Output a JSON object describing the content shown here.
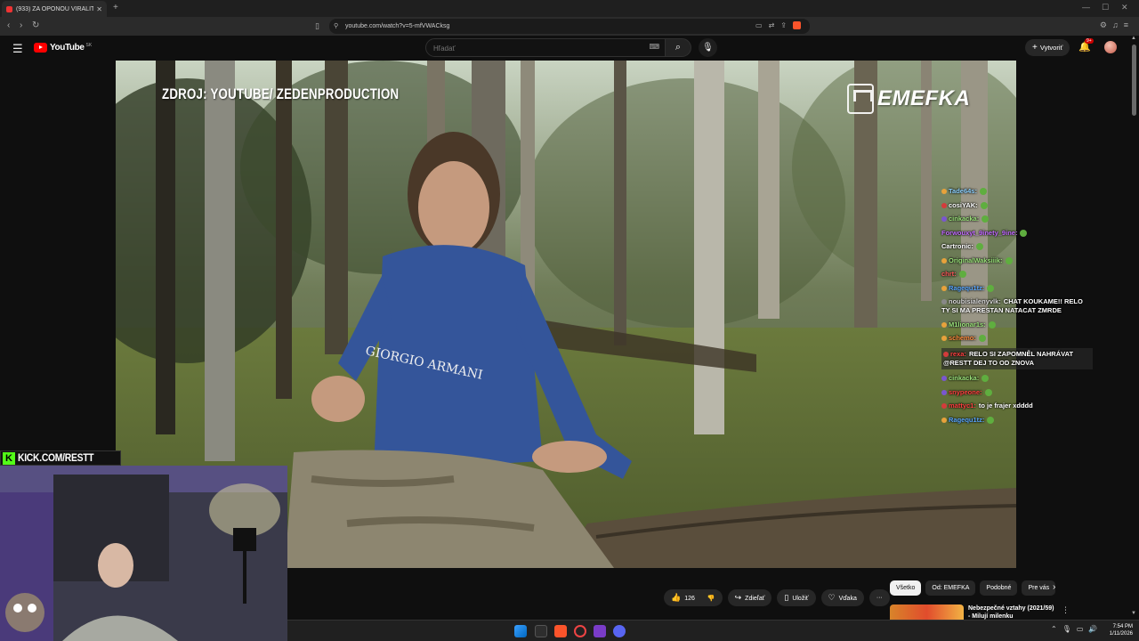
{
  "browser": {
    "tab_title": "(933) ZA OPONOU VIRALITY",
    "tab_close": "✕",
    "new_tab": "+",
    "url": "youtube.com/watch?v=5-mfVWACksg"
  },
  "youtube": {
    "logo_text": "YouTube",
    "region": "SK",
    "search_placeholder": "Hľadať",
    "create_label": "Vytvoriť",
    "notification_count": "9+"
  },
  "video": {
    "source_caption": "ZDROJ: YOUTUBE/ ZEDENPRODUCTION",
    "channel_watermark": "EMEFKA"
  },
  "chat": {
    "messages": [
      {
        "user": "Tade64s:",
        "text": "",
        "color": "#8fd3ff",
        "badge": "#e8a23b"
      },
      {
        "user": "cosiYAK:",
        "text": "",
        "color": "#ffffff",
        "badge": "#d43b3b"
      },
      {
        "user": "cinkacka:",
        "text": "",
        "color": "#9be37a",
        "badge": "#7a56d0"
      },
      {
        "user": "Forwouxyt_9inety_9ine:",
        "text": "",
        "color": "#c26bff",
        "badge": ""
      },
      {
        "user": "Cartronic:",
        "text": "",
        "color": "#ffffff",
        "badge": ""
      },
      {
        "user": "OriginalWaksiiik:",
        "text": "",
        "color": "#9be37a",
        "badge": "#e8a23b"
      },
      {
        "user": "chrt:",
        "text": "",
        "color": "#ff5a5a",
        "badge": ""
      },
      {
        "user": "Ragequ1tz:",
        "text": "",
        "color": "#5aa8ff",
        "badge": "#e8a23b"
      },
      {
        "user": "noubisialenyvlk:",
        "text": "CHAT KOUKAME!! RELO TY SI MA PRESTAN NATACAT ZMRDE",
        "color": "#d9d9d9",
        "badge": "#888888"
      },
      {
        "user": "M1lionar1s:",
        "text": "",
        "color": "#9be37a",
        "badge": "#e8a23b"
      },
      {
        "user": "schemo:",
        "text": "",
        "color": "#ff8a3d",
        "badge": "#e8a23b"
      },
      {
        "user": "rexa:",
        "text": "RELO SI ZAPOMNĚL NAHRÁVAT @RESTT DEJ TO OD ZNOVA",
        "color": "#ff4040",
        "badge": "#d43b3b",
        "highlight": true
      },
      {
        "user": "cinkacka:",
        "text": "",
        "color": "#9be37a",
        "badge": "#7a56d0"
      },
      {
        "user": "snypeone:",
        "text": "",
        "color": "#ff4040",
        "badge": "#7a56d0"
      },
      {
        "user": "mattyc1:",
        "text": "to je frajer xdddd",
        "color": "#ff4040",
        "badge": "#d43b3b"
      },
      {
        "user": "Ragequ1tz:",
        "text": "",
        "color": "#5aa8ff",
        "badge": "#e8a23b"
      }
    ]
  },
  "overlay": {
    "kick_letter": "K",
    "kick_text": "KICK.COM/RESTT"
  },
  "actions": {
    "like_count": "126",
    "share_label": "Zdieľať",
    "save_label": "Uložiť",
    "thanks_label": "Vďaka",
    "more_label": "···"
  },
  "chips": [
    "Všetko",
    "Od: EMEFKA",
    "Podobné",
    "Pre vás"
  ],
  "recommendation": {
    "title": "Nebezpečné vztahy (2021/59) - Milují milenku"
  },
  "taskbar": {
    "time": "7:54 PM",
    "date": "1/11/2026"
  }
}
